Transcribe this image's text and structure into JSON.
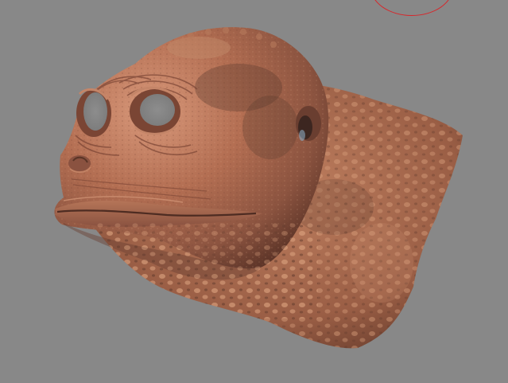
{
  "viewport": {
    "background_color": "#888888",
    "model": {
      "subject": "sculpted-reptile-head",
      "skin_color": "#a8634a",
      "highlight_color": "#d59670",
      "shadow_color": "#5a3428",
      "spot_color": "#6b4738"
    },
    "brush_cursor": {
      "color": "#d8262a"
    }
  }
}
